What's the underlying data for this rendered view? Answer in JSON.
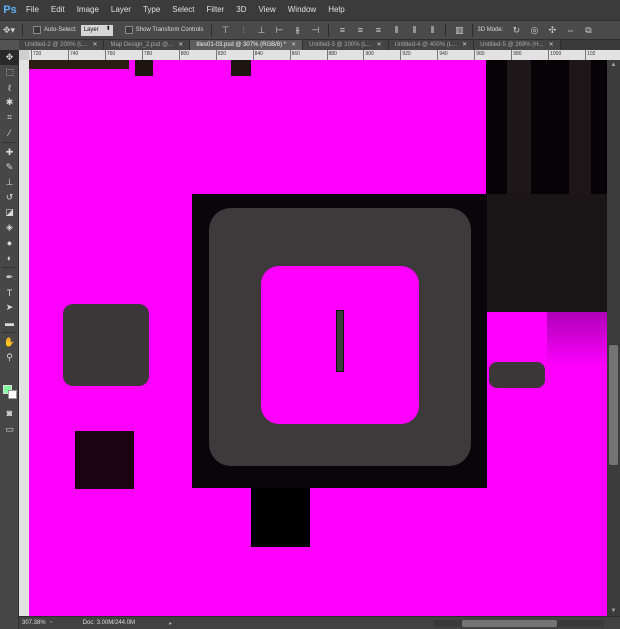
{
  "app": {
    "logo": "Ps"
  },
  "menu": [
    "File",
    "Edit",
    "Image",
    "Layer",
    "Type",
    "Select",
    "Filter",
    "3D",
    "View",
    "Window",
    "Help"
  ],
  "options": {
    "auto_select_label": "Auto-Select:",
    "auto_select_value": "Layer",
    "show_transform_label": "Show Transform Controls",
    "mode_label": "3D Mode:"
  },
  "tabs": [
    {
      "label": "Untitled-2 @ 200% (L...",
      "active": false
    },
    {
      "label": "Map Design_2.psd @...",
      "active": false
    },
    {
      "label": "tiles01-03.psd @ 307% (RGB/8) *",
      "active": true
    },
    {
      "label": "Untitled-3 @ 100% (L...",
      "active": false
    },
    {
      "label": "Untitled-4 @ 400% (L...",
      "active": false
    },
    {
      "label": "Untitled-5 @ 269% (H...",
      "active": false
    }
  ],
  "ruler_top": [
    "720",
    "740",
    "760",
    "780",
    "800",
    "820",
    "840",
    "860",
    "880",
    "900",
    "920",
    "940",
    "960",
    "980",
    "1000",
    "102"
  ],
  "status": {
    "zoom": "307.38%",
    "doc": "Doc: 3.00M/244.0M"
  },
  "colors": {
    "canvas": "#ff00ff",
    "foreground": "#7fffa0",
    "background": "#ffffff"
  }
}
